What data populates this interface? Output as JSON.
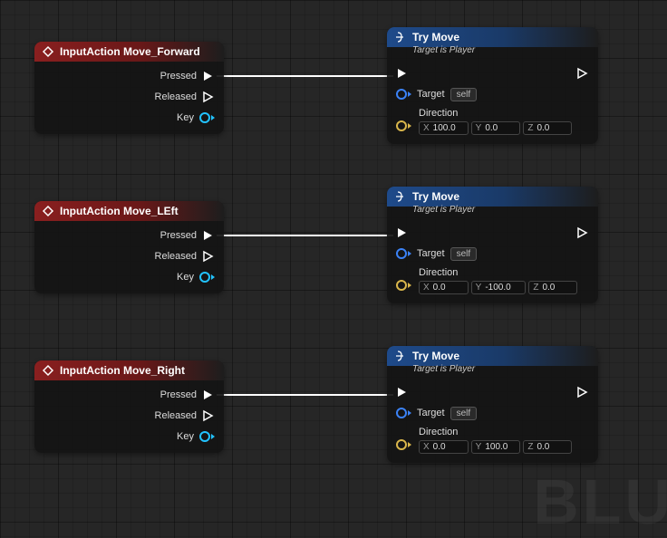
{
  "watermark": "BLU",
  "input_nodes": [
    {
      "title": "InputAction Move_Forward",
      "pressed": "Pressed",
      "released": "Released",
      "key": "Key"
    },
    {
      "title": "InputAction Move_LEft",
      "pressed": "Pressed",
      "released": "Released",
      "key": "Key"
    },
    {
      "title": "InputAction Move_Right",
      "pressed": "Pressed",
      "released": "Released",
      "key": "Key"
    }
  ],
  "try_nodes": [
    {
      "title": "Try Move",
      "subtitle": "Target is Player",
      "target_label": "Target",
      "target_value": "self",
      "dir_label": "Direction",
      "x": "100.0",
      "y": "0.0",
      "z": "0.0"
    },
    {
      "title": "Try Move",
      "subtitle": "Target is Player",
      "target_label": "Target",
      "target_value": "self",
      "dir_label": "Direction",
      "x": "0.0",
      "y": "-100.0",
      "z": "0.0"
    },
    {
      "title": "Try Move",
      "subtitle": "Target is Player",
      "target_label": "Target",
      "target_value": "self",
      "dir_label": "Direction",
      "x": "0.0",
      "y": "100.0",
      "z": "0.0"
    }
  ],
  "axis": {
    "x": "X",
    "y": "Y",
    "z": "Z"
  }
}
